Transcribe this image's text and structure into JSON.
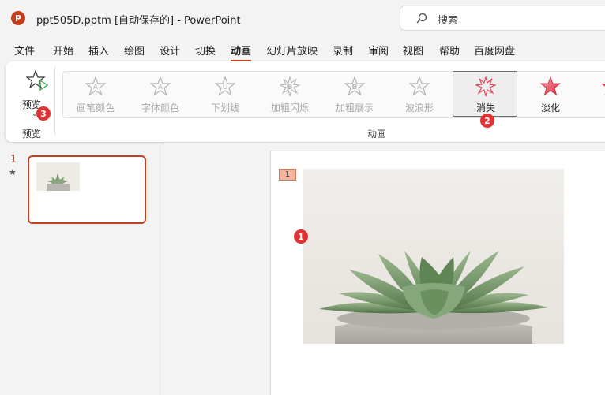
{
  "titlebar": {
    "app_logo": "P",
    "title": "ppt505D.pptm [自动保存的]  -  PowerPoint",
    "search_placeholder": "搜索"
  },
  "menu": {
    "tabs": [
      "文件",
      "开始",
      "插入",
      "绘图",
      "设计",
      "切换",
      "动画",
      "幻灯片放映",
      "录制",
      "审阅",
      "视图",
      "帮助",
      "百度网盘"
    ],
    "active": "动画"
  },
  "ribbon": {
    "preview_button": "预览",
    "preview_group": "预览",
    "animation_group": "动画",
    "animations": [
      {
        "label": "画笔颜色",
        "glyph": "A",
        "state": "disabled"
      },
      {
        "label": "字体颜色",
        "glyph": "A",
        "state": "disabled"
      },
      {
        "label": "下划线",
        "glyph": "U",
        "state": "disabled"
      },
      {
        "label": "加粗闪烁",
        "glyph": "B",
        "state": "disabled"
      },
      {
        "label": "加粗展示",
        "glyph": "B",
        "state": "disabled"
      },
      {
        "label": "波浪形",
        "glyph": "A",
        "state": "disabled"
      },
      {
        "label": "消失",
        "glyph": "",
        "state": "selected"
      },
      {
        "label": "淡化",
        "glyph": "",
        "state": "enabled"
      }
    ]
  },
  "badges": {
    "photo_marker": "1",
    "disappear_marker": "2",
    "preview_marker": "3"
  },
  "slides_pane": {
    "slide_number": "1",
    "animation_indicator": "★"
  },
  "slide": {
    "animation_tag": "1"
  },
  "colors": {
    "accent": "#c43e1c",
    "badge": "#e03232",
    "tag_fill": "#f4b39d"
  }
}
